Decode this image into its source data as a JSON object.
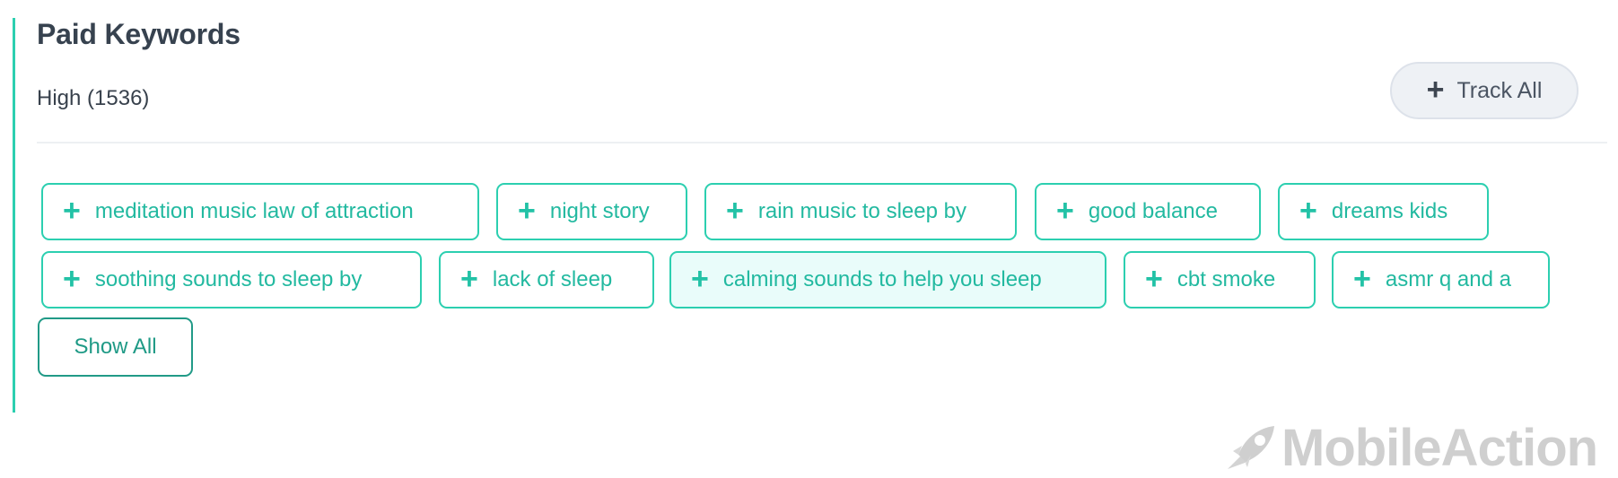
{
  "section": {
    "title": "Paid Keywords",
    "level_label": "High (1536)",
    "track_all_label": "Track All"
  },
  "keywords": [
    {
      "label": "meditation music law of attraction"
    },
    {
      "label": "night story"
    },
    {
      "label": "rain music to sleep by"
    },
    {
      "label": "good balance"
    },
    {
      "label": "dreams kids"
    },
    {
      "label": "soothing sounds to sleep by"
    },
    {
      "label": "lack of sleep"
    },
    {
      "label": "calming sounds to help you sleep",
      "highlighted": true
    },
    {
      "label": "cbt smoke"
    },
    {
      "label": "asmr q and a"
    }
  ],
  "show_all_label": "Show All",
  "brand": {
    "name": "MobileAction",
    "logo_icon": "rocket-icon"
  },
  "colors": {
    "accent": "#2ccfb0",
    "chip_text": "#22b9a0",
    "chip_highlight_bg": "#e9fcfa",
    "title_text": "#37424f",
    "button_bg": "#eef1f5",
    "logo": "#cfcfcf"
  }
}
